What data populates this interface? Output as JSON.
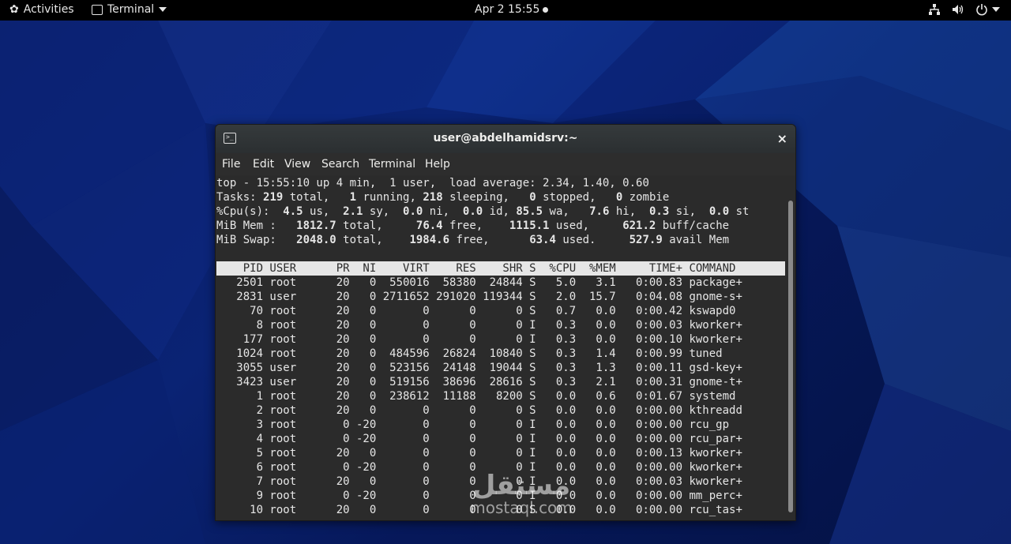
{
  "topbar": {
    "activities": "Activities",
    "app_name": "Terminal",
    "datetime": "Apr 2  15:55"
  },
  "window": {
    "title": "user@abdelhamidsrv:~",
    "close_glyph": "×",
    "menu": [
      "File",
      "Edit",
      "View",
      "Search",
      "Terminal",
      "Help"
    ]
  },
  "top_output": {
    "line1": "top - 15:55:10 up 4 min,  1 user,  load average: 2.34, 1.40, 0.60",
    "tasks": {
      "label": "Tasks: ",
      "total": "219",
      "total_l": " total,   ",
      "running": "1",
      "running_l": " running, ",
      "sleeping": "218",
      "sleeping_l": " sleeping,   ",
      "stopped": "0",
      "stopped_l": " stopped,   ",
      "zombie": "0",
      "zombie_l": " zombie"
    },
    "cpu": {
      "label": "%Cpu(s):  ",
      "us": "4.5",
      "us_l": " us,  ",
      "sy": "2.1",
      "sy_l": " sy,  ",
      "ni": "0.0",
      "ni_l": " ni,  ",
      "id": "0.0",
      "id_l": " id, ",
      "wa": "85.5",
      "wa_l": " wa,   ",
      "hi": "7.6",
      "hi_l": " hi,  ",
      "si": "0.3",
      "si_l": " si,  ",
      "st": "0.0",
      "st_l": " st"
    },
    "mem": {
      "label": "MiB Mem :   ",
      "total": "1812.7",
      "total_l": " total,     ",
      "free": "76.4",
      "free_l": " free,    ",
      "used": "1115.1",
      "used_l": " used,     ",
      "buff": "621.2",
      "buff_l": " buff/cache"
    },
    "swap": {
      "label": "MiB Swap:   ",
      "total": "2048.0",
      "total_l": " total,    ",
      "free": "1984.6",
      "free_l": " free,      ",
      "used": "63.4",
      "used_l": " used.     ",
      "avail": "527.9",
      "avail_l": " avail Mem"
    },
    "header": "    PID USER      PR  NI    VIRT    RES    SHR S  %CPU  %MEM     TIME+ COMMAND",
    "processes": [
      "   2501 root      20   0  550016  58380  24844 S   5.0   3.1   0:00.83 package+",
      "   2831 user      20   0 2711652 291020 119344 S   2.0  15.7   0:04.08 gnome-s+",
      "     70 root      20   0       0      0      0 S   0.7   0.0   0:00.42 kswapd0",
      "      8 root      20   0       0      0      0 I   0.3   0.0   0:00.03 kworker+",
      "    177 root      20   0       0      0      0 I   0.3   0.0   0:00.10 kworker+",
      "   1024 root      20   0  484596  26824  10840 S   0.3   1.4   0:00.99 tuned",
      "   3055 user      20   0  523156  24148  19044 S   0.3   1.3   0:00.11 gsd-key+",
      "   3423 user      20   0  519156  38696  28616 S   0.3   2.1   0:00.31 gnome-t+",
      "      1 root      20   0  238612  11188   8200 S   0.0   0.6   0:01.67 systemd",
      "      2 root      20   0       0      0      0 S   0.0   0.0   0:00.00 kthreadd",
      "      3 root       0 -20       0      0      0 I   0.0   0.0   0:00.00 rcu_gp",
      "      4 root       0 -20       0      0      0 I   0.0   0.0   0:00.00 rcu_par+",
      "      5 root      20   0       0      0      0 I   0.0   0.0   0:00.13 kworker+",
      "      6 root       0 -20       0      0      0 I   0.0   0.0   0:00.00 kworker+",
      "      7 root      20   0       0      0      0 I   0.0   0.0   0:00.03 kworker+",
      "      9 root       0 -20       0      0      0 I   0.0   0.0   0:00.00 mm_perc+",
      "     10 root      20   0       0      0      0 S   0.0   0.0   0:00.00 rcu_tas+"
    ]
  },
  "watermark": {
    "arabic": "مستقل",
    "latin": "mostaql.com"
  }
}
